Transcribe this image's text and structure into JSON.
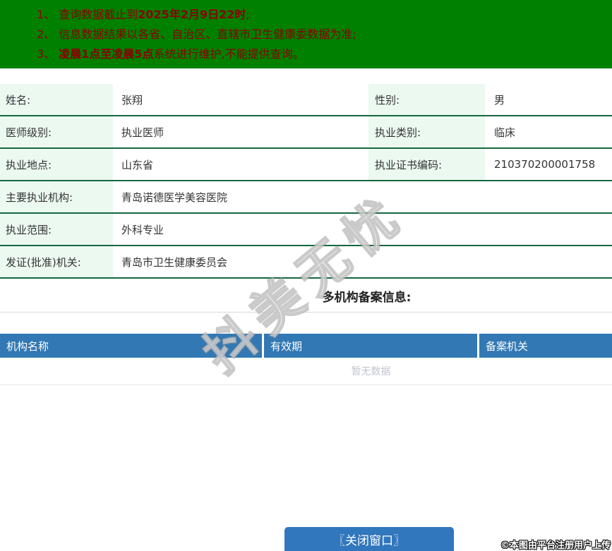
{
  "banner": {
    "notices": [
      {
        "prefix": "1、 查询数据截止到",
        "bold": "2025年2月9日22时",
        "suffix": ";"
      },
      {
        "prefix": "2、 信息数据结果以各省、自治区、直辖市卫生健康委数据为准;",
        "bold": "",
        "suffix": ""
      },
      {
        "prefix": "3、 ",
        "bold": "凌晨1点至凌晨5点",
        "suffix": "系统进行维护,不能提供查询。"
      }
    ]
  },
  "profile": {
    "rows": [
      {
        "label1": "姓名:",
        "value1": "张翔",
        "label2": "性别:",
        "value2": "男"
      },
      {
        "label1": "医师级别:",
        "value1": "执业医师",
        "label2": "执业类别:",
        "value2": "临床"
      },
      {
        "label1": "执业地点:",
        "value1": "山东省",
        "label2": "执业证书编码:",
        "value2": "210370200001758"
      },
      {
        "label1": "主要执业机构:",
        "value1": "青岛诺德医学美容医院"
      },
      {
        "label1": "执业范围:",
        "value1": "外科专业"
      },
      {
        "label1": "发证(批准)机关:",
        "value1": "青岛市卫生健康委员会"
      }
    ]
  },
  "multi_org": {
    "section_title": "多机构备案信息:",
    "table": {
      "headers": [
        "机构名称",
        "有效期",
        "备案机关"
      ],
      "empty_text": "暂无数据"
    }
  },
  "watermark": {
    "text": "抖美无忧"
  },
  "footer": {
    "close_button": "〖关闭窗口〗",
    "copyright": "©本图由平台注册用户上传"
  },
  "colors": {
    "banner_bg": "#008000",
    "banner_text": "#8b0000",
    "table_header_bg": "#3278b4",
    "button_bg": "#3177bd",
    "label_cell_bg": "#ebf9f1",
    "row_border_green": "#17663f"
  }
}
